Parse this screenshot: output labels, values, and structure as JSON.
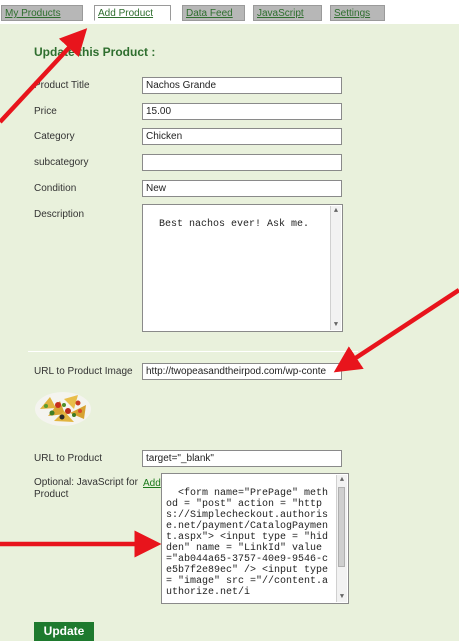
{
  "tabs": [
    {
      "label": "My Products",
      "active": false
    },
    {
      "label": "Add Product",
      "active": true
    },
    {
      "label": "Data Feed",
      "active": false
    },
    {
      "label": "JavaScript",
      "active": false
    },
    {
      "label": "Settings",
      "active": false
    }
  ],
  "form": {
    "heading": "Update this Product :",
    "product_title": {
      "label": "Product Title",
      "value": "Nachos Grande"
    },
    "price": {
      "label": "Price",
      "value": "15.00"
    },
    "category": {
      "label": "Category",
      "value": "Chicken"
    },
    "subcategory": {
      "label": "subcategory",
      "value": ""
    },
    "condition": {
      "label": "Condition",
      "value": "New"
    },
    "description": {
      "label": "Description",
      "value": "Best nachos ever! Ask me."
    },
    "image_url": {
      "label": "URL to Product Image",
      "value": "http://twopeasandtheirpod.com/wp-conte"
    },
    "product_url": {
      "label": "URL to Product",
      "value": "target=\"_blank\""
    },
    "javascript": {
      "label": "Optional: JavaScript for Product",
      "add_link": "Add",
      "value": "<form name=\"PrePage\" method = \"post\" action = \"https://Simplecheckout.authorise.net/payment/CatalogPayment.aspx\"> <input type = \"hidden\" name = \"LinkId\" value =\"ab044a65-3757-40e9-9546-ce5b7f2e89ec\" /> <input type = \"image\" src =\"//content.authorize.net/i"
    },
    "update_label": "Update"
  },
  "colors": {
    "panel_bg": "#e9f1dc",
    "accent_green": "#2e6e2e",
    "button_green": "#1e7a2e",
    "arrow_red": "#e8141c"
  },
  "icons": [
    "scroll-up-icon",
    "scroll-down-icon",
    "annotation-arrow-icon"
  ]
}
